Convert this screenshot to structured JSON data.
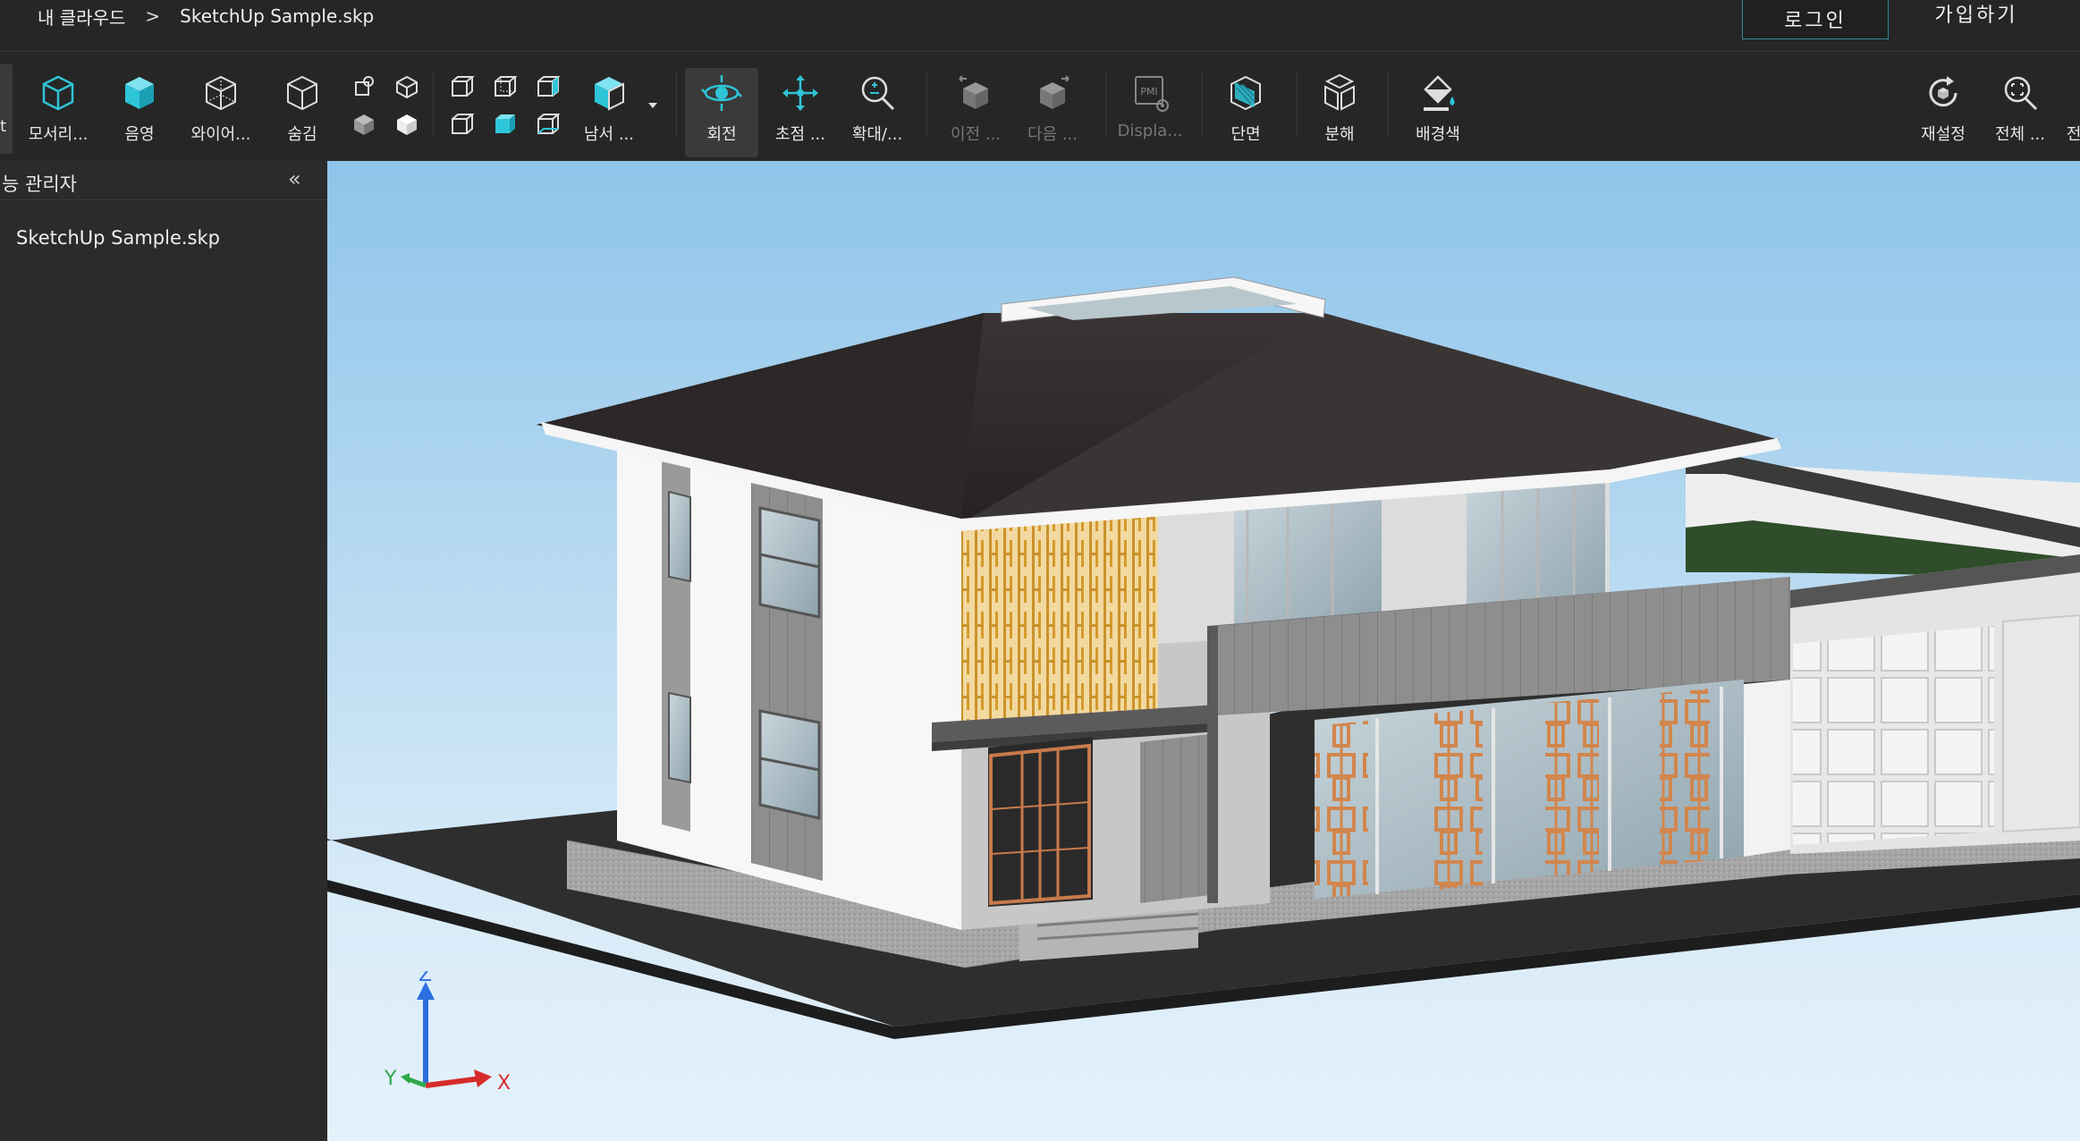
{
  "breadcrumb": {
    "root": "내 클라우드",
    "separator": ">",
    "current": "SketchUp Sample.skp"
  },
  "auth": {
    "login": "로그인",
    "signup": "가입하기"
  },
  "toolbar": {
    "cut_left": "t",
    "items": [
      {
        "label": "모서리...",
        "icon": "cube-edges-icon"
      },
      {
        "label": "음영",
        "icon": "cube-shaded-icon"
      },
      {
        "label": "와이어...",
        "icon": "cube-wireframe-icon"
      },
      {
        "label": "숨김",
        "icon": "cube-hidden-icon"
      },
      {
        "label": "남서 ...",
        "icon": "cube-southwest-icon"
      },
      {
        "label": "회전",
        "icon": "orbit-icon"
      },
      {
        "label": "초점 ...",
        "icon": "pan-icon"
      },
      {
        "label": "확대/...",
        "icon": "zoom-icon"
      },
      {
        "label": "이전 ...",
        "icon": "previous-view-icon"
      },
      {
        "label": "다음 ...",
        "icon": "next-view-icon"
      },
      {
        "label": "Displa...",
        "icon": "pmi-display-icon"
      },
      {
        "label": "단면",
        "icon": "section-icon"
      },
      {
        "label": "분해",
        "icon": "explode-icon"
      },
      {
        "label": "배경색",
        "icon": "background-color-icon"
      },
      {
        "label": "재설정",
        "icon": "reset-icon"
      },
      {
        "label": "전체 ...",
        "icon": "zoom-fit-icon"
      },
      {
        "label": "전",
        "icon": "cut-off-icon"
      }
    ],
    "pmi_text": "PMI"
  },
  "sidebar": {
    "title": "능 관리자",
    "collapse": "«",
    "items": [
      "SketchUp Sample.skp"
    ]
  },
  "axes": {
    "z": "Z",
    "y": "Y",
    "x": "X"
  },
  "colors": {
    "accent": "#2fc5d9",
    "login_border": "#2e8a9a",
    "axis_x": "#d62b2b",
    "axis_y": "#2fa84a",
    "axis_z": "#2c6ee0"
  }
}
